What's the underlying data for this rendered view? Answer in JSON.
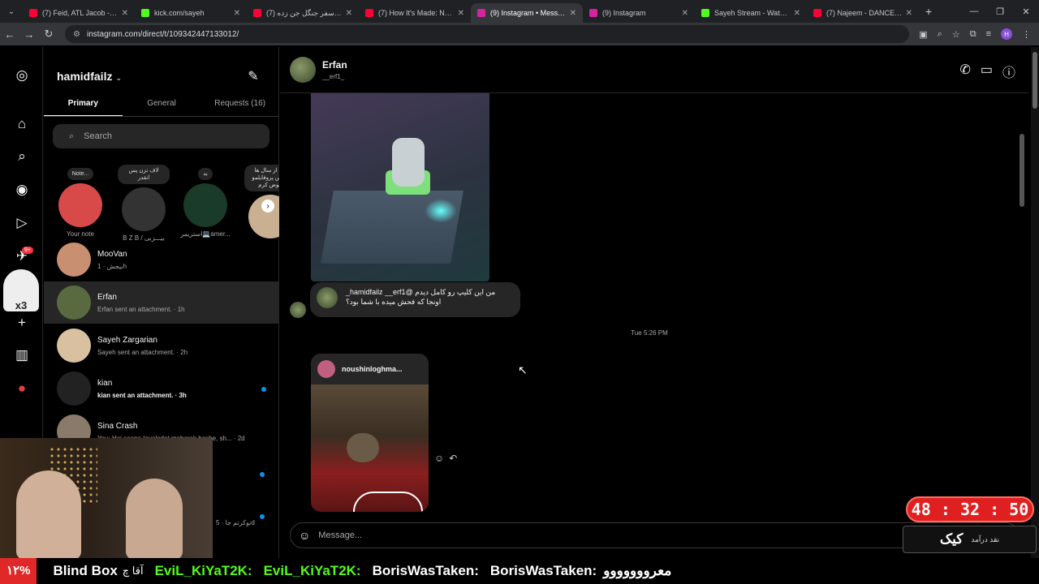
{
  "browser": {
    "tabs": [
      {
        "title": "(7) Feid, ATL Jacob - LUNA",
        "color": "#ff0033"
      },
      {
        "title": "kick.com/sayeh",
        "color": "#53fc18"
      },
      {
        "title": "(7) آغاز سفر جنگل جن زده",
        "color": "#ff0033"
      },
      {
        "title": "(7) How It's Made: Nutcra",
        "color": "#ff0033"
      },
      {
        "title": "(9) Instagram • Messages",
        "color": "#d6249f"
      },
      {
        "title": "(9) Instagram",
        "color": "#d6249f"
      },
      {
        "title": "Sayeh Stream - Watch Live",
        "color": "#53fc18"
      },
      {
        "title": "(7) Najeem - DANCE ON",
        "color": "#ff0033"
      }
    ],
    "url": "instagram.com/direct/t/109342447133012/",
    "profile_initial": "H"
  },
  "inbox": {
    "username": "hamidfailz",
    "tabs": [
      "Primary",
      "General",
      "Requests (16)"
    ],
    "search_placeholder": "Search",
    "notes": [
      {
        "bubble": "Note...",
        "label": "Your note",
        "color": "#d84a4a"
      },
      {
        "bubble": "لاف نزن پس انقدر",
        "label": "B Z B / بیـــزبی",
        "color": "#333"
      },
      {
        "bubble": "بد",
        "label": "استریمر💻amer...",
        "color": "#1a3a2a"
      },
      {
        "bubble": "بعد از سال ها عکس پروفایلمو عوض کرم",
        "label": "Arghavan",
        "color": "#c8b090"
      }
    ],
    "notifications_badge": "9+",
    "threads": [
      {
        "name": "MooVan",
        "preview": "بیجش · 1h",
        "bold": false,
        "unread": false,
        "color": "#c89070"
      },
      {
        "name": "Erfan",
        "preview": "Erfan sent an attachment. · 1h",
        "bold": false,
        "unread": false,
        "color": "#5a6a40"
      },
      {
        "name": "Sayeh Zargarian",
        "preview": "Sayeh sent an attachment. · 2h",
        "bold": false,
        "unread": false,
        "color": "#d8c0a0"
      },
      {
        "name": "kian",
        "preview": "kian sent an attachment. · 3h",
        "bold": true,
        "unread": true,
        "color": "#222"
      },
      {
        "name": "Sina Crash",
        "preview": "You: Hai seena tavalodet mobarak bashe, sh... · 2d",
        "bold": false,
        "unread": false,
        "color": "#8a7a6a"
      }
    ],
    "partial_preview": "نوکرتم جا · 5d"
  },
  "chat": {
    "name": "Erfan",
    "handle": "__erf1_",
    "reply_text_line1": "من این کلیپ رو کامل دیدم @hamidfailz __erf1_",
    "reply_text_line2": "اونجا که فحش میده با شما بود؟",
    "timestamp": "Tue 5:26 PM",
    "post_user": "noushinloghma...",
    "composer_placeholder": "Message..."
  },
  "overlay": {
    "timer": "48 : 32 : 50",
    "cam_counter": "x3",
    "kick_label": "کیک",
    "kick_sub": "نقد درآمد",
    "ticker_pct": "۱۲%",
    "ticker_title": "Blind Box",
    "ticker_chat": "آقا چ",
    "ticker_users": [
      "EviL_KiYaT2K:",
      "EviL_KiYaT2K:",
      "BorisWasTaken:",
      "BorisWasTaken:"
    ],
    "ticker_tail": "معرووووووو"
  }
}
